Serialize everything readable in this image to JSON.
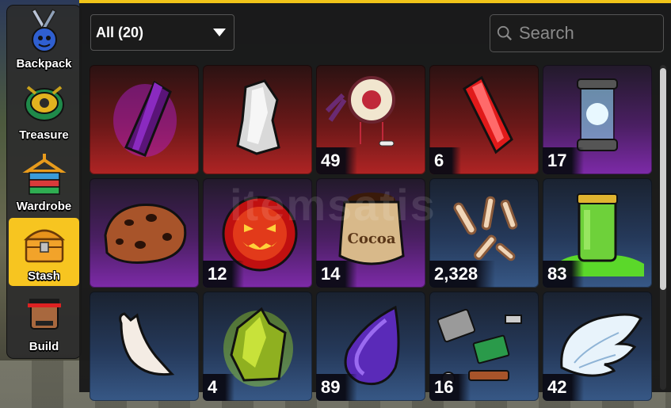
{
  "nav": {
    "items": [
      {
        "label": "Backpack",
        "icon": "backpack-icon"
      },
      {
        "label": "Treasure",
        "icon": "treasure-icon"
      },
      {
        "label": "Wardrobe",
        "icon": "wardrobe-icon"
      },
      {
        "label": "Stash",
        "icon": "stash-chest-icon",
        "active": true
      },
      {
        "label": "Build",
        "icon": "build-avatar-icon"
      }
    ]
  },
  "filter": {
    "selected": "All (20)"
  },
  "search": {
    "placeholder": "Search"
  },
  "watermark": {
    "text": "itemsatis"
  },
  "colors": {
    "accent": "#f7c520",
    "red_card": "#b02424",
    "purple_card": "#7d2aa8",
    "blue_card": "#375886"
  },
  "items": [
    {
      "name": "purple-crystal",
      "qty": "",
      "rarity": "red"
    },
    {
      "name": "silver-shard",
      "qty": "",
      "rarity": "red"
    },
    {
      "name": "dreamcatcher",
      "qty": "49",
      "rarity": "red"
    },
    {
      "name": "red-crystal",
      "qty": "6",
      "rarity": "red"
    },
    {
      "name": "lightning-capsule",
      "qty": "17",
      "rarity": "purple"
    },
    {
      "name": "cookie-rock",
      "qty": "",
      "rarity": "purple"
    },
    {
      "name": "demonic-wisp",
      "qty": "12",
      "rarity": "purple"
    },
    {
      "name": "cocoa-bag",
      "qty": "14",
      "rarity": "purple"
    },
    {
      "name": "bones",
      "qty": "2,328",
      "rarity": "blue"
    },
    {
      "name": "ectoplasm-jar",
      "qty": "83",
      "rarity": "blue"
    },
    {
      "name": "fang",
      "qty": "",
      "rarity": "blue"
    },
    {
      "name": "green-ore",
      "qty": "4",
      "rarity": "blue"
    },
    {
      "name": "purple-drop",
      "qty": "89",
      "rarity": "blue"
    },
    {
      "name": "scrap-parts",
      "qty": "16",
      "rarity": "blue"
    },
    {
      "name": "angel-wings",
      "qty": "42",
      "rarity": "blue"
    }
  ],
  "cocoa_label": "Cocoa"
}
